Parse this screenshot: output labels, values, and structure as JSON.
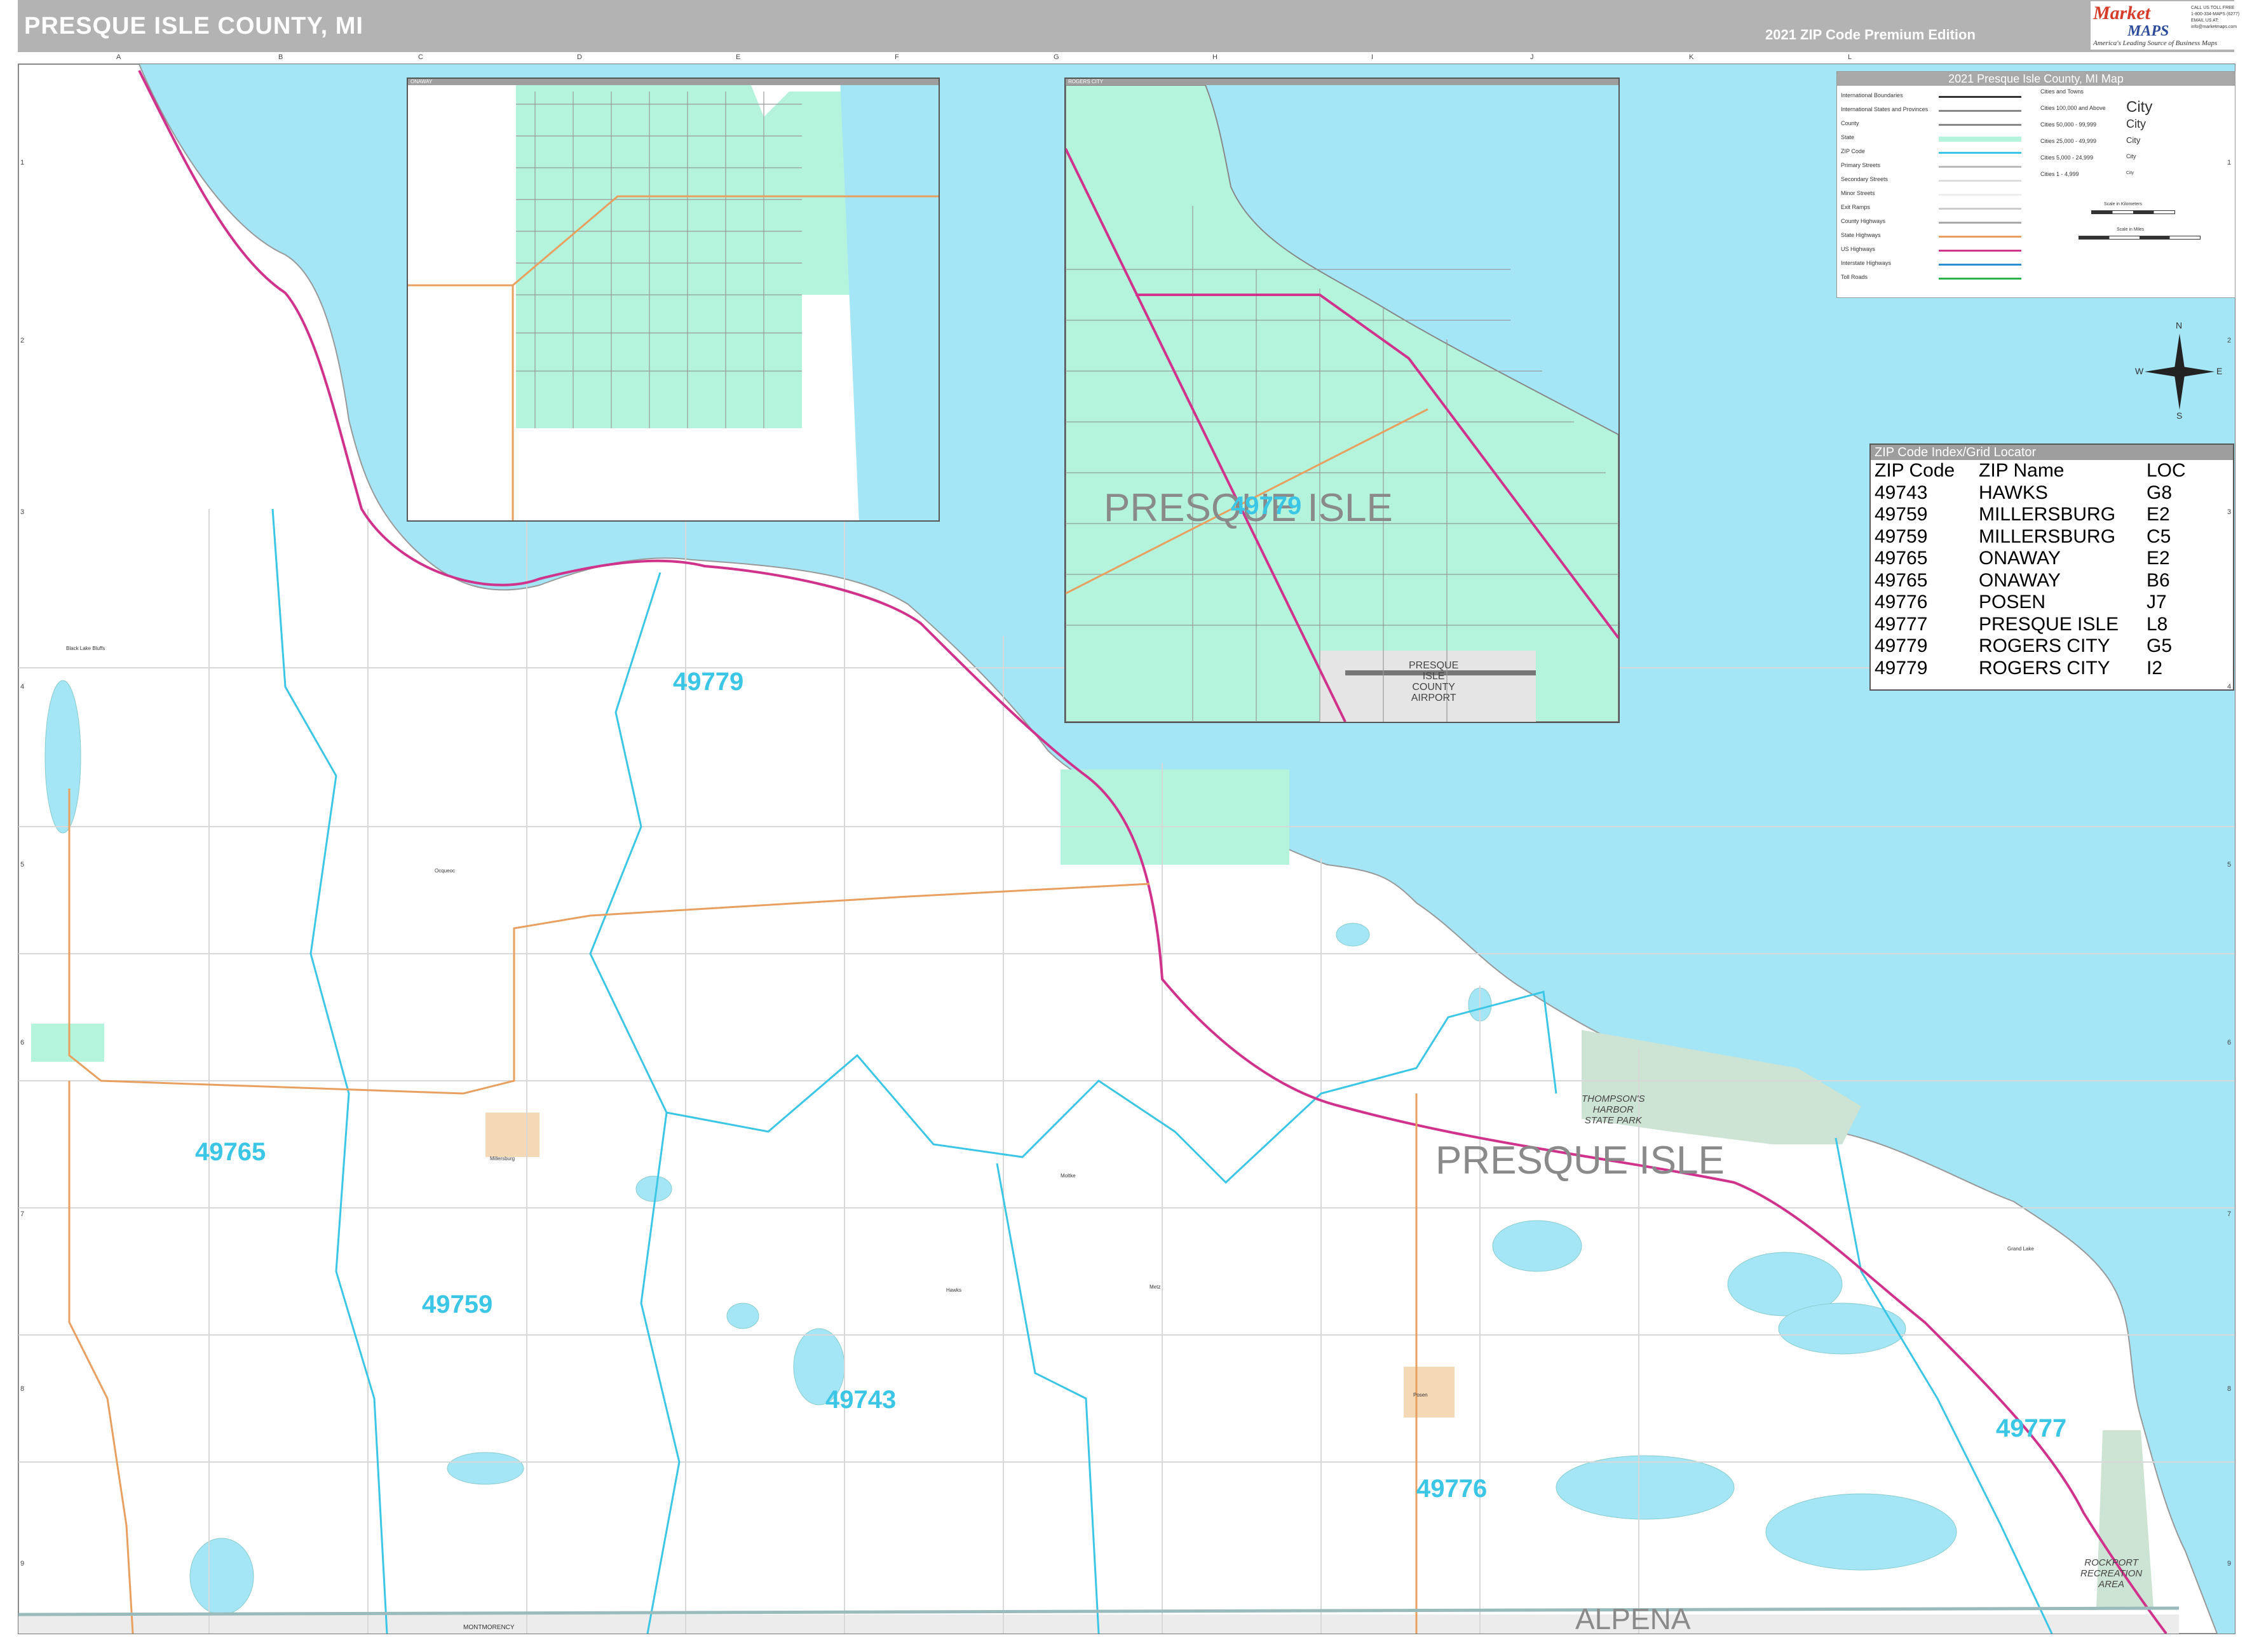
{
  "header": {
    "title": "PRESQUE ISLE COUNTY, MI",
    "edition": "2021 ZIP Code Premium Edition",
    "logo_text_1": "Market",
    "logo_text_2": "MAPS",
    "logo_tagline": "America's Leading Source of Business Maps",
    "logo_contact": "CALL US TOLL FREE\n1-800-334-MAPS (6277)\nEMAIL US AT:\ninfo@marketmaps.com"
  },
  "grid": {
    "columns": [
      "A",
      "B",
      "C",
      "D",
      "E",
      "F",
      "G",
      "H",
      "I",
      "J",
      "K",
      "L"
    ],
    "rows": [
      "1",
      "2",
      "3",
      "4",
      "5",
      "6",
      "7",
      "8",
      "9"
    ]
  },
  "colors": {
    "water": "#a4e6f6",
    "land": "#ffffff",
    "city": "#b4f4dc",
    "park": "#cde4d4",
    "town": "#f5d9b7",
    "zip_boundary": "#3cc6e6",
    "us_highway": "#d0338c",
    "state_highway": "#e8a060",
    "neighbor_county": "#ececec"
  },
  "zip_labels": [
    "49779",
    "49765",
    "49759",
    "49743",
    "49776",
    "49777"
  ],
  "inset_zip_label": "49779",
  "county_labels": {
    "main": "PRESQUE ISLE",
    "inset": "PRESQUE ISLE",
    "south": "ALPENA",
    "southwest_small": "MONTMORENCY"
  },
  "park_labels": {
    "thompsons_harbor": "THOMPSON'S\nHARBOR\nSTATE PARK",
    "rockport": "ROCKPORT\nRECREATION\nAREA",
    "airport": "PRESQUE\nISLE\nCOUNTY\nAIRPORT"
  },
  "inset_titles": {
    "onaway": "ONAWAY",
    "rogers_city": "ROGERS CITY"
  },
  "towns": [
    "Grand Lake",
    "Posen",
    "Hawks",
    "Metz",
    "Millersburg",
    "Onaway",
    "Rogers City",
    "Presque Isle",
    "Black Lake Bluffs",
    "Ocqueoc",
    "Moltke"
  ],
  "legend": {
    "title": "2021 Presque Isle County, MI Map",
    "items": [
      {
        "label": "International Boundaries",
        "color": "#333333"
      },
      {
        "label": "International States and Provinces",
        "color": "#888888"
      },
      {
        "label": "County",
        "color": "#888888"
      },
      {
        "label": "State",
        "color": "#b4f4dc"
      },
      {
        "label": "ZIP Code",
        "color": "#3cc6e6"
      },
      {
        "label": "Primary Streets",
        "color": "#bbbbbb"
      },
      {
        "label": "Secondary Streets",
        "color": "#dddddd"
      },
      {
        "label": "Minor Streets",
        "color": "#eeeeee"
      },
      {
        "label": "Exit Ramps",
        "color": "#cccccc"
      },
      {
        "label": "County Highways",
        "color": "#aaaaaa"
      },
      {
        "label": "State Highways",
        "color": "#e8a060"
      },
      {
        "label": "US Highways",
        "color": "#d0338c"
      },
      {
        "label": "Interstate Highways",
        "color": "#2a8fd0"
      },
      {
        "label": "Toll Roads",
        "color": "#2bb24a"
      }
    ],
    "cities_heading": "Cities and Towns",
    "city_classes": [
      {
        "label": "Cities 100,000 and Above",
        "mark": "City"
      },
      {
        "label": "Cities 50,000 - 99,999",
        "mark": "City"
      },
      {
        "label": "Cities 25,000 - 49,999",
        "mark": "City"
      },
      {
        "label": "Cities 5,000 - 24,999",
        "mark": "City"
      },
      {
        "label": "Cities 1 - 4,999",
        "mark": "City"
      }
    ],
    "scale_km": "Scale in Kilometers",
    "scale_mi": "Scale in Miles"
  },
  "compass": {
    "n": "N",
    "s": "S",
    "e": "E",
    "w": "W"
  },
  "zip_index": {
    "title": "ZIP Code Index/Grid Locator",
    "headers": [
      "ZIP Code",
      "ZIP Name",
      "LOC"
    ],
    "rows": [
      [
        "49743",
        "HAWKS",
        "G8"
      ],
      [
        "49759",
        "MILLERSBURG",
        "E2"
      ],
      [
        "49759",
        "MILLERSBURG",
        "C5"
      ],
      [
        "49765",
        "ONAWAY",
        "E2"
      ],
      [
        "49765",
        "ONAWAY",
        "B6"
      ],
      [
        "49776",
        "POSEN",
        "J7"
      ],
      [
        "49777",
        "PRESQUE ISLE",
        "L8"
      ],
      [
        "49779",
        "ROGERS CITY",
        "G5"
      ],
      [
        "49779",
        "ROGERS CITY",
        "I2"
      ]
    ]
  }
}
